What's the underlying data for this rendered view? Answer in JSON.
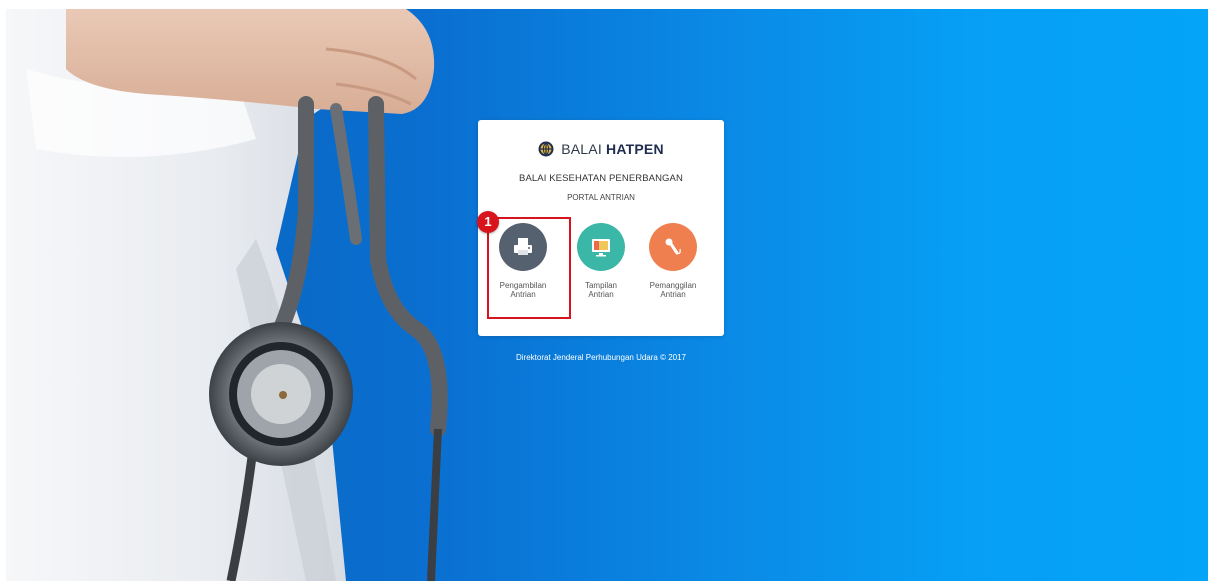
{
  "brand": {
    "light": "BALAI",
    "bold": "HATPEN",
    "logo_icon": "globe-emblem-icon"
  },
  "portal": {
    "org_title": "BALAI KESEHATAN PENERBANGAN",
    "subtitle": "PORTAL ANTRIAN"
  },
  "menu": [
    {
      "line1": "Pengambilan",
      "line2": "Antrian",
      "icon": "printer-icon",
      "color": "#566170"
    },
    {
      "line1": "Tampilan",
      "line2": "Antrian",
      "icon": "monitor-icon",
      "color": "#3ab7a6"
    },
    {
      "line1": "Pemanggilan",
      "line2": "Antrian",
      "icon": "microphone-icon",
      "color": "#f07f4f"
    }
  ],
  "annotation": {
    "step_number": "1",
    "highlight_color": "#d8141c"
  },
  "footer": {
    "text": "Direktorat Jenderal Perhubungan Udara © 2017"
  },
  "colors": {
    "background_blue": "#0a8ae6",
    "card": "#ffffff"
  }
}
